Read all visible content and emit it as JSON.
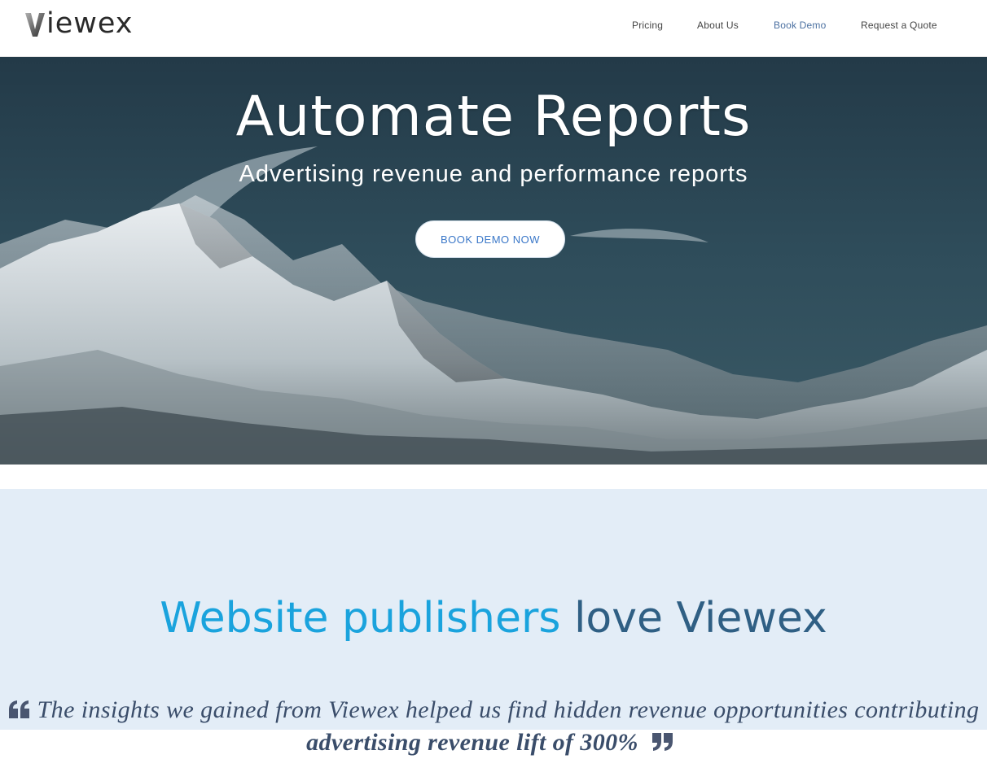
{
  "header": {
    "logo_text": "iewex",
    "nav": [
      {
        "label": "Pricing"
      },
      {
        "label": "About Us"
      },
      {
        "label": "Book Demo"
      },
      {
        "label": "Request a Quote"
      }
    ],
    "active_nav": "Book Demo"
  },
  "hero": {
    "title": "Automate Reports",
    "subtitle": "Advertising revenue and performance reports",
    "cta_label": "BOOK DEMO NOW"
  },
  "section": {
    "title_part1": "Website publishers",
    "title_part2": "love Viewex",
    "quote_line1": "The insights we gained from Viewex helped us find hidden revenue opportunities contributing",
    "quote_line2_bold": "advertising revenue lift of 300%"
  },
  "colors": {
    "accent_blue": "#1aa3dd",
    "dark_blue": "#2f5f84",
    "section_bg": "#e3edf7",
    "cta_text": "#3a77c8"
  }
}
